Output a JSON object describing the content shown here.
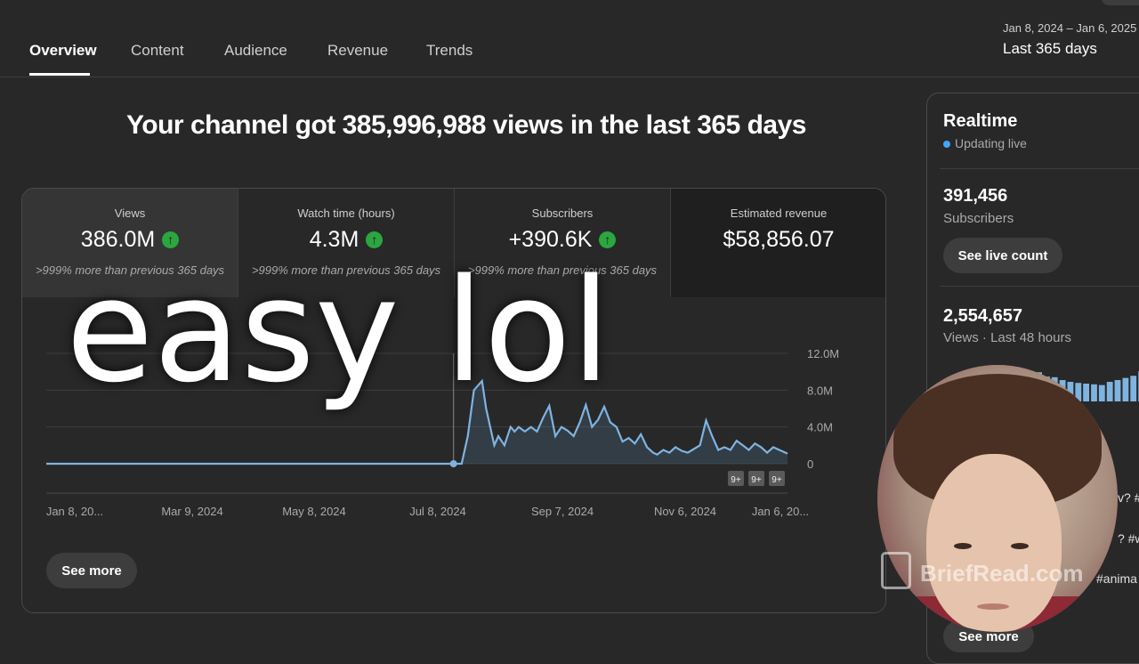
{
  "tabs": [
    {
      "label": "Overview",
      "active": true
    },
    {
      "label": "Content",
      "active": false
    },
    {
      "label": "Audience",
      "active": false
    },
    {
      "label": "Revenue",
      "active": false
    },
    {
      "label": "Trends",
      "active": false
    }
  ],
  "date_range": {
    "range": "Jan 8, 2024 – Jan 6, 2025",
    "period": "Last 365 days"
  },
  "headline": "Your channel got 385,996,988 views in the last 365 days",
  "metrics": [
    {
      "label": "Views",
      "value": "386.0M",
      "up": true,
      "note": ">999% more than previous 365 days"
    },
    {
      "label": "Watch time (hours)",
      "value": "4.3M",
      "up": true,
      "note": ">999% more than previous 365 days"
    },
    {
      "label": "Subscribers",
      "value": "+390.6K",
      "up": true,
      "note": ">999% more than previous 365 days"
    },
    {
      "label": "Estimated revenue",
      "value": "$58,856.07",
      "up": false,
      "note": ""
    }
  ],
  "chart_data": {
    "type": "area",
    "title": "",
    "xlabel": "",
    "ylabel": "",
    "x_tick_labels": [
      "Jan 8, 20...",
      "Mar 9, 2024",
      "May 8, 2024",
      "Jul 8, 2024",
      "Sep 7, 2024",
      "Nov 6, 2024",
      "Jan 6, 20..."
    ],
    "y_tick_labels": [
      "0",
      "4.0M",
      "8.0M",
      "12.0M"
    ],
    "ylim": [
      0,
      12000000
    ],
    "y_axis_position": "right",
    "grid": true,
    "series": [
      {
        "values_x_day": [
          0,
          50,
          100,
          150,
          180,
          190,
          195,
          200,
          204,
          207,
          210,
          214,
          216,
          218,
          220,
          222,
          225,
          228,
          230,
          232,
          235,
          238,
          241,
          244,
          247,
          250,
          253,
          256,
          259,
          262,
          265,
          268,
          271,
          274,
          277,
          280,
          283,
          286,
          289,
          292,
          295,
          298,
          300,
          303,
          306,
          309,
          312,
          315,
          318,
          321,
          324,
          327,
          330,
          333,
          336,
          339,
          342,
          345,
          348,
          351,
          354,
          357,
          360,
          364
        ],
        "values": [
          0,
          0,
          0,
          0,
          0,
          0,
          0,
          0,
          0,
          3000000,
          8000000,
          9000000,
          6000000,
          4000000,
          2000000,
          3000000,
          2000000,
          4000000,
          3500000,
          4000000,
          3500000,
          4000000,
          3500000,
          5000000,
          6300000,
          3000000,
          4000000,
          3600000,
          3000000,
          4500000,
          6400000,
          4000000,
          4800000,
          6200000,
          4500000,
          4000000,
          2400000,
          2800000,
          2200000,
          3200000,
          1800000,
          1200000,
          1000000,
          1500000,
          1200000,
          1800000,
          1400000,
          1200000,
          1600000,
          2000000,
          4700000,
          3000000,
          1500000,
          1800000,
          1500000,
          2500000,
          2000000,
          1500000,
          2200000,
          1800000,
          1200000,
          1800000,
          1500000,
          1100000
        ]
      }
    ],
    "badges": [
      "9+",
      "9+",
      "9+"
    ]
  },
  "see_more": "See more",
  "realtime": {
    "title": "Realtime",
    "status": "Updating live",
    "subs_value": "391,456",
    "subs_label": "Subscribers",
    "live_button": "See live count",
    "views_value": "2,554,657",
    "views_label": "Views · Last 48 hours",
    "bars": [
      40,
      50,
      55,
      60,
      45,
      55,
      62,
      70,
      58,
      64,
      80,
      75,
      82,
      70,
      68,
      60,
      55,
      52,
      50,
      48,
      46,
      55,
      60,
      66,
      72,
      85
    ],
    "edge_texts": [
      "v? #",
      "? #w",
      "#anima"
    ],
    "see_more": "See more"
  },
  "overlay_caption": "easy lol",
  "watermark": "BriefRead.com"
}
